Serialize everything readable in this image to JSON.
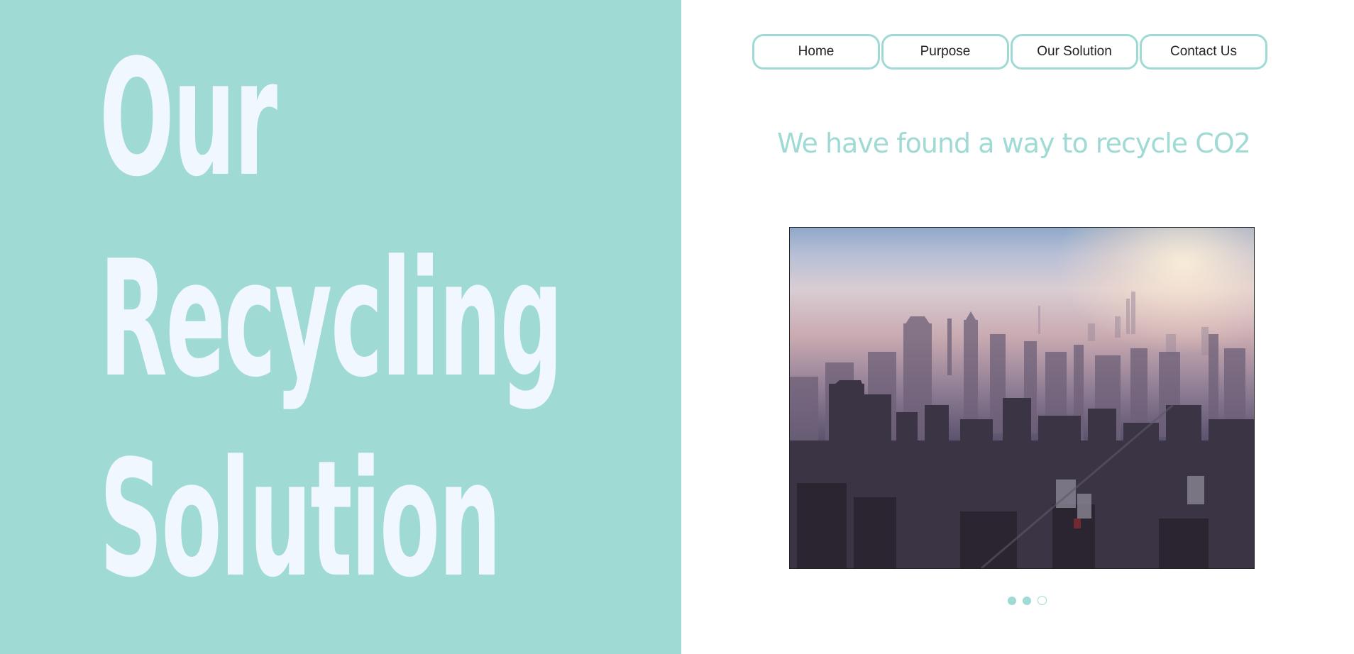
{
  "hero": {
    "line1": "Our",
    "line2": "Recycling",
    "line3": "Solution"
  },
  "nav": {
    "items": [
      {
        "label": "Home"
      },
      {
        "label": "Purpose"
      },
      {
        "label": "Our Solution"
      },
      {
        "label": "Contact Us"
      }
    ]
  },
  "tagline": "We have found a way to recycle CO2",
  "carousel": {
    "slide_count": 3,
    "active_index": 2
  },
  "colors": {
    "accent": "#a0dad5",
    "hero_text": "#f0f7ff"
  }
}
